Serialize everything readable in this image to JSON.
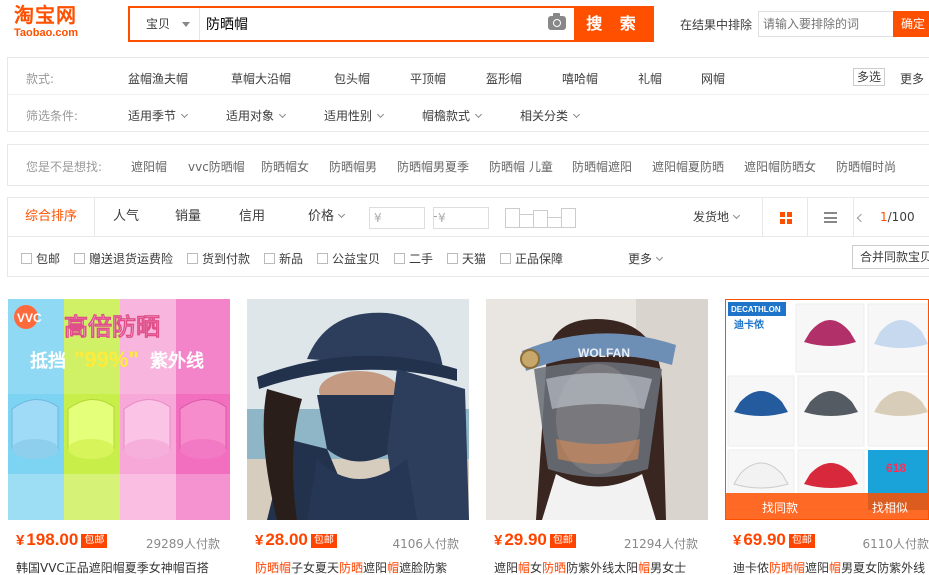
{
  "header": {
    "logo_cn": "淘宝网",
    "logo_en": "Taobao.com",
    "search_category": "宝贝",
    "search_query": "防晒帽",
    "search_button": "搜 索",
    "exclude_label": "在结果中排除",
    "exclude_placeholder": "请输入要排除的词",
    "exclude_button": "确定"
  },
  "filters": {
    "style_label": "款式:",
    "styles": [
      "盆帽渔夫帽",
      "草帽大沿帽",
      "包头帽",
      "平顶帽",
      "盔形帽",
      "嘻哈帽",
      "礼帽",
      "网帽"
    ],
    "multi_select": "多选",
    "more": "更多",
    "cond_label": "筛选条件:",
    "conditions": [
      "适用季节",
      "适用对象",
      "适用性别",
      "帽檐款式",
      "相关分类"
    ]
  },
  "suggest": {
    "label": "您是不是想找:",
    "items": [
      "遮阳帽",
      "vvc防晒帽",
      "防晒帽女",
      "防晒帽男",
      "防晒帽男夏季",
      "防晒帽 儿童",
      "防晒帽遮阳",
      "遮阳帽夏防晒",
      "遮阳帽防晒女",
      "防晒帽时尚"
    ]
  },
  "sortbar": {
    "tabs": [
      "综合排序",
      "人气",
      "销量",
      "信用",
      "价格"
    ],
    "price_min_placeholder": "¥",
    "price_max_placeholder": "¥",
    "price_dash": "-",
    "ship_from": "发货地",
    "page_current": "1",
    "page_total": "/100"
  },
  "checks": {
    "items": [
      "包邮",
      "赠送退货运费险",
      "货到付款",
      "新品",
      "公益宝贝",
      "二手",
      "天猫",
      "正品保障"
    ],
    "more": "更多",
    "merge": "合并同款宝贝"
  },
  "products": [
    {
      "price": "198.00",
      "yen": "¥",
      "baoyou": "包邮",
      "sales": "29289人付款",
      "title": "韩国VVC正品遮阳帽夏季女神帽百搭",
      "image": {
        "brand": "VVC",
        "headline": "高倍防晒",
        "sub_prefix": "抵挡",
        "sub_pct": "\"99%\"",
        "sub_suffix": "紫外线"
      }
    },
    {
      "price": "28.00",
      "yen": "¥",
      "baoyou": "包邮",
      "sales": "4106人付款",
      "title_parts": [
        "防晒帽",
        "子女夏天",
        "防晒",
        "遮阳",
        "帽",
        "遮脸防紫"
      ]
    },
    {
      "price": "29.90",
      "yen": "¥",
      "baoyou": "包邮",
      "sales": "21294人付款",
      "title_parts": [
        "遮阳",
        "帽",
        "女",
        "防晒",
        "防紫外线太阳",
        "帽",
        "男女士"
      ],
      "image": {
        "visor_brand": "WOLFAN"
      }
    },
    {
      "price": "69.90",
      "yen": "¥",
      "baoyou": "包邮",
      "sales": "6110人付款",
      "title_parts": [
        "迪卡侬",
        "防晒帽",
        "遮阳",
        "帽",
        "男夏女防紫外线"
      ],
      "image": {
        "brand": "DECATHLON",
        "brand_cn": "迪卡侬",
        "overlay_left": "找同款",
        "overlay_right": "找相似",
        "corner": "618"
      }
    }
  ],
  "colors": {
    "accent": "#ff5000",
    "price": "#ff4400"
  }
}
